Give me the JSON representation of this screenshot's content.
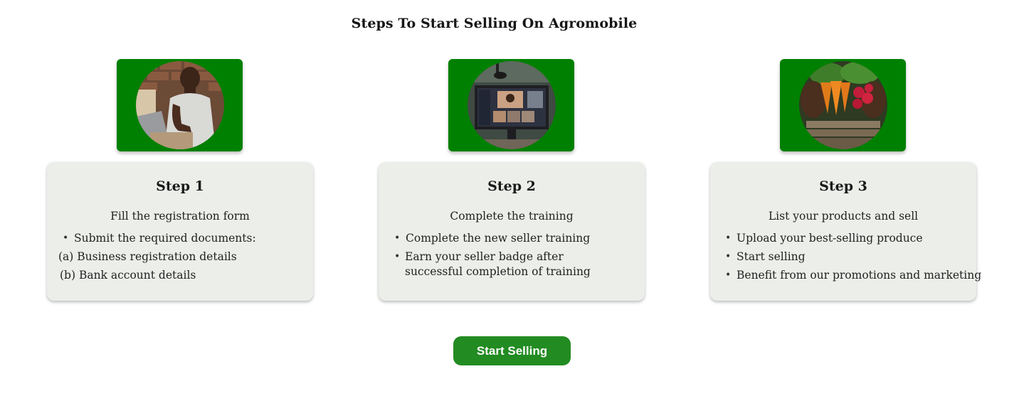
{
  "page": {
    "title": "Steps To Start Selling On Agromobile"
  },
  "steps": [
    {
      "title": "Step 1",
      "subtitle": "Fill the registration form",
      "image": "person-using-laptop-photo",
      "lines": [
        "Submit the required documents:",
        "(a) Business registration details",
        "(b) Bank account details"
      ]
    },
    {
      "title": "Step 2",
      "subtitle": "Complete the training",
      "image": "video-call-training-photo",
      "lines": [
        "Complete the new seller training",
        "Earn your seller badge after",
        "successful completion of training"
      ]
    },
    {
      "title": "Step 3",
      "subtitle": "List your products and sell",
      "image": "fresh-produce-crate-photo",
      "lines": [
        "Upload your best-selling produce",
        "Start selling",
        "Benefit from our promotions and marketing"
      ]
    }
  ],
  "cta": {
    "label": "Start Selling"
  },
  "colors": {
    "image_box": "#008000",
    "card_bg": "#ebeee9",
    "button_bg": "#228b22",
    "button_text": "#ffffff"
  }
}
